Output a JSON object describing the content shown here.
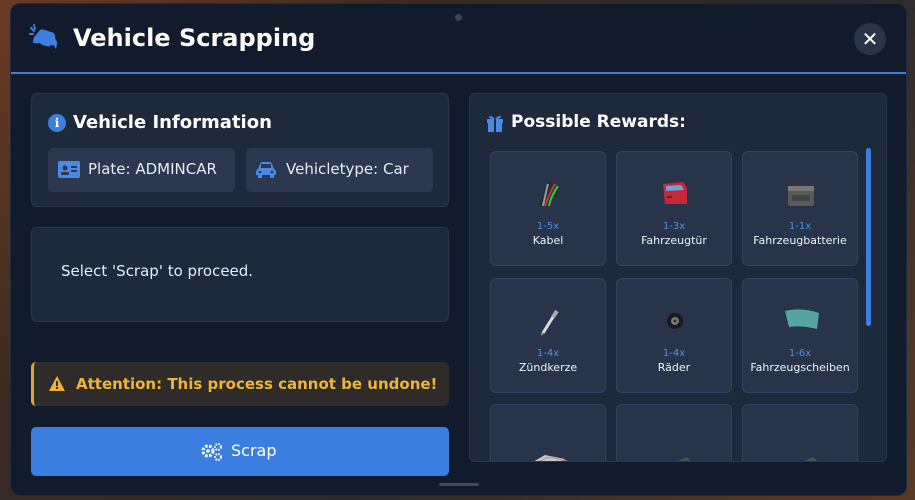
{
  "header": {
    "title": "Vehicle Scrapping",
    "close_label": "✕"
  },
  "info": {
    "title": "Vehicle Information",
    "plate": "Plate: ADMINCAR",
    "vehicletype": "Vehicletype: Car"
  },
  "status": {
    "text": "Select 'Scrap' to proceed."
  },
  "warning": {
    "text": "Attention: This process cannot be undone!"
  },
  "actions": {
    "scrap_label": "Scrap"
  },
  "rewards": {
    "title": "Possible Rewards:",
    "items": [
      {
        "qty": "1-5x",
        "name": "Kabel",
        "icon": "cable-icon"
      },
      {
        "qty": "1-3x",
        "name": "Fahrzeugtür",
        "icon": "car-door-icon"
      },
      {
        "qty": "1-1x",
        "name": "Fahrzeugbatterie",
        "icon": "car-battery-icon"
      },
      {
        "qty": "1-4x",
        "name": "Zündkerze",
        "icon": "spark-plug-icon"
      },
      {
        "qty": "1-4x",
        "name": "Räder",
        "icon": "wheel-icon"
      },
      {
        "qty": "1-6x",
        "name": "Fahrzeugscheiben",
        "icon": "windshield-icon"
      },
      {
        "qty": "",
        "name": "",
        "icon": "scrap-metal-icon"
      },
      {
        "qty": "",
        "name": "",
        "icon": "metal-bar-icon"
      },
      {
        "qty": "",
        "name": "",
        "icon": "metal-bar-icon"
      }
    ]
  },
  "colors": {
    "accent": "#3d7fdc",
    "warning": "#f0b43a",
    "background": "#111b2c"
  }
}
